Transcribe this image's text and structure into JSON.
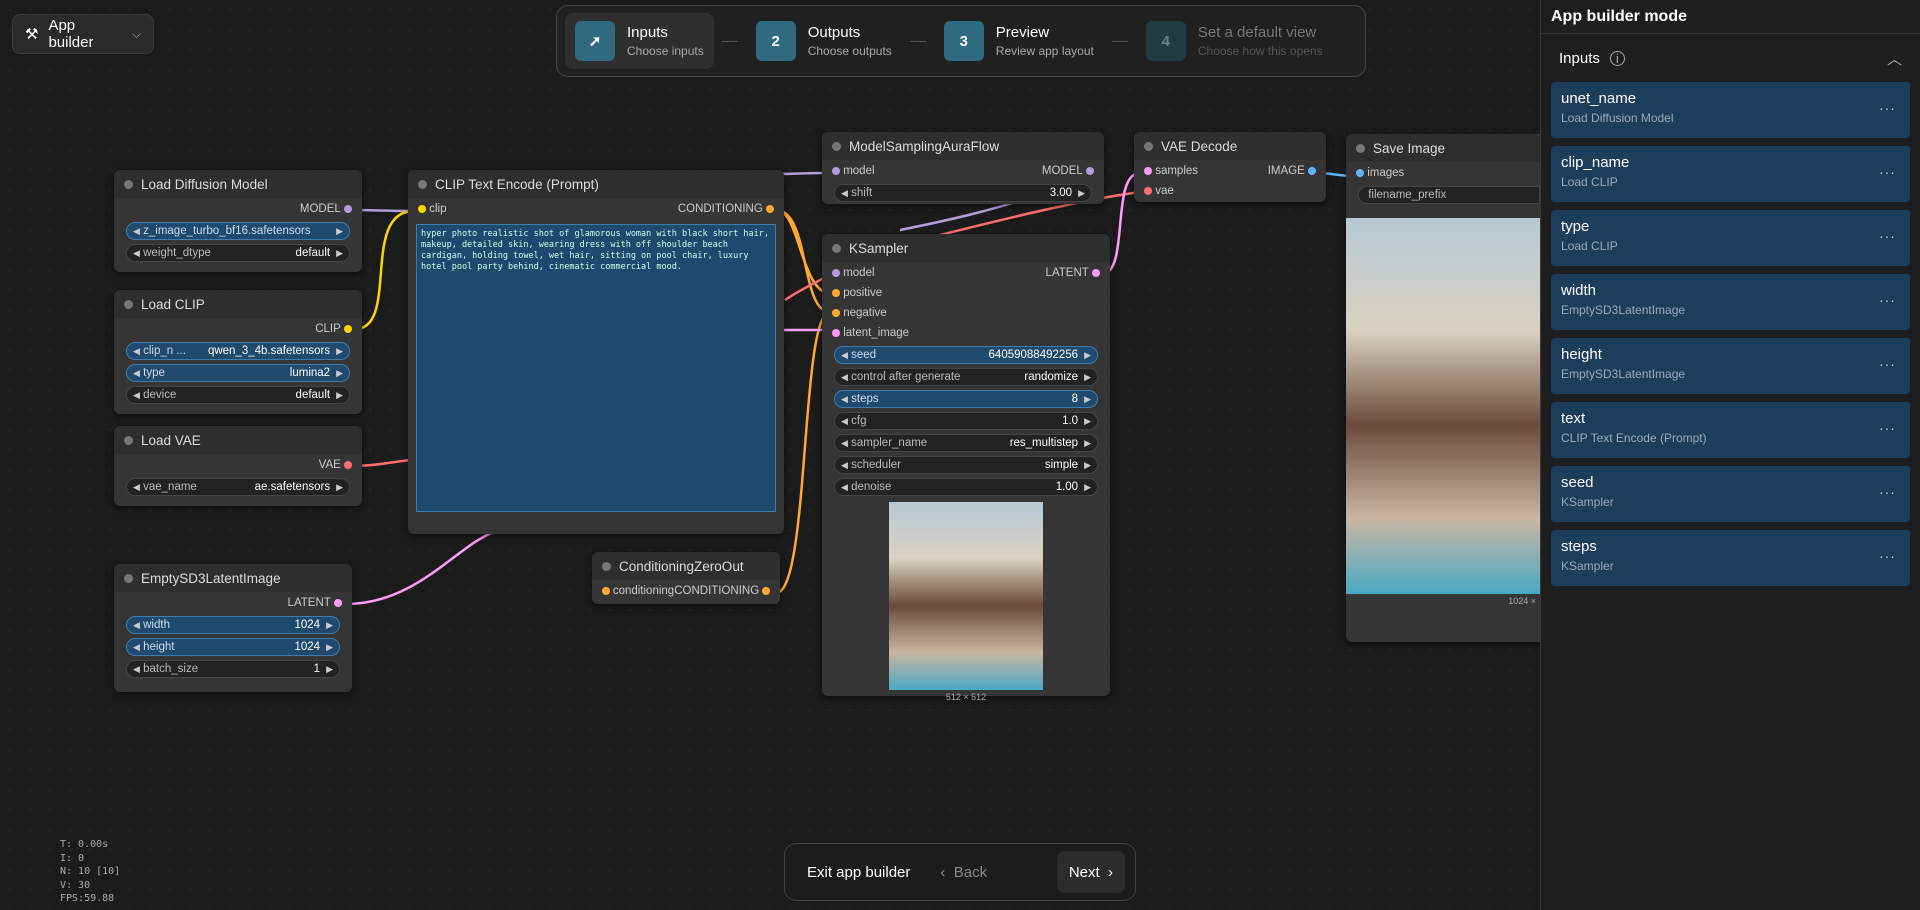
{
  "app_button": {
    "label": "App builder"
  },
  "stepper": [
    {
      "num": "",
      "title": "Inputs",
      "sub": "Choose inputs"
    },
    {
      "num": "2",
      "title": "Outputs",
      "sub": "Choose outputs"
    },
    {
      "num": "3",
      "title": "Preview",
      "sub": "Review app layout"
    },
    {
      "num": "4",
      "title": "Set a default view",
      "sub": "Choose how this opens"
    }
  ],
  "nodes": {
    "load_diffusion": {
      "title": "Load Diffusion Model",
      "out": "MODEL",
      "w1": "z_image_turbo_bf16.safetensors",
      "w2_label": "weight_dtype",
      "w2_value": "default"
    },
    "load_clip": {
      "title": "Load CLIP",
      "out": "CLIP",
      "w1_label": "clip_n ...",
      "w1_value": "qwen_3_4b.safetensors",
      "w2_label": "type",
      "w2_value": "lumina2",
      "w3_label": "device",
      "w3_value": "default"
    },
    "load_vae": {
      "title": "Load VAE",
      "out": "VAE",
      "w1_label": "vae_name",
      "w1_value": "ae.safetensors"
    },
    "empty_latent": {
      "title": "EmptySD3LatentImage",
      "out": "LATENT",
      "w1_label": "width",
      "w1_value": "1024",
      "w2_label": "height",
      "w2_value": "1024",
      "w3_label": "batch_size",
      "w3_value": "1"
    },
    "clip_text": {
      "title": "CLIP Text Encode (Prompt)",
      "in": "clip",
      "out": "CONDITIONING",
      "prompt": "hyper photo realistic shot of glamorous woman with black short hair, makeup, detailed skin, wearing dress with off shoulder beach cardigan, holding towel, wet hair, sitting on pool chair, luxury hotel pool party behind, cinematic commercial mood."
    },
    "cond_zero": {
      "title": "ConditioningZeroOut",
      "in": "conditioning",
      "out": "CONDITIONING"
    },
    "model_sampling": {
      "title": "ModelSamplingAuraFlow",
      "in": "model",
      "out": "MODEL",
      "w1_label": "shift",
      "w1_value": "3.00"
    },
    "ksampler": {
      "title": "KSampler",
      "in1": "model",
      "in2": "positive",
      "in3": "negative",
      "in4": "latent_image",
      "out": "LATENT",
      "widgets": [
        {
          "label": "seed",
          "value": "64059088492256"
        },
        {
          "label": "control after generate",
          "value": "randomize"
        },
        {
          "label": "steps",
          "value": "8"
        },
        {
          "label": "cfg",
          "value": "1.0"
        },
        {
          "label": "sampler_name",
          "value": "res_multistep"
        },
        {
          "label": "scheduler",
          "value": "simple"
        },
        {
          "label": "denoise",
          "value": "1.00"
        }
      ],
      "img_size": "512 × 512"
    },
    "vae_decode": {
      "title": "VAE Decode",
      "in1": "samples",
      "in2": "vae",
      "out": "IMAGE"
    },
    "save_image": {
      "title": "Save Image",
      "in": "images",
      "w1": "filename_prefix",
      "img_size": "1024 ×"
    }
  },
  "panel": {
    "title": "App builder mode",
    "section": "Inputs",
    "items": [
      {
        "name": "unet_name",
        "source": "Load Diffusion Model"
      },
      {
        "name": "clip_name",
        "source": "Load CLIP"
      },
      {
        "name": "type",
        "source": "Load CLIP"
      },
      {
        "name": "width",
        "source": "EmptySD3LatentImage"
      },
      {
        "name": "height",
        "source": "EmptySD3LatentImage"
      },
      {
        "name": "text",
        "source": "CLIP Text Encode (Prompt)"
      },
      {
        "name": "seed",
        "source": "KSampler"
      },
      {
        "name": "steps",
        "source": "KSampler"
      }
    ]
  },
  "bottom": {
    "exit": "Exit app builder",
    "back": "Back",
    "next": "Next"
  },
  "stats": {
    "t": "T: 0.00s",
    "i": "I: 0",
    "n": "N: 10 [10]",
    "v": "V: 30",
    "fps": "FPS:59.88"
  },
  "colors": {
    "accent": "#2f6a80",
    "selected": "#1f4a6e",
    "model": "#b39ddb",
    "clip": "#ffd500",
    "vae": "#ff6e6e",
    "latent": "#ff9cf9",
    "conditioning": "#ffa931",
    "image": "#64b5f6"
  }
}
